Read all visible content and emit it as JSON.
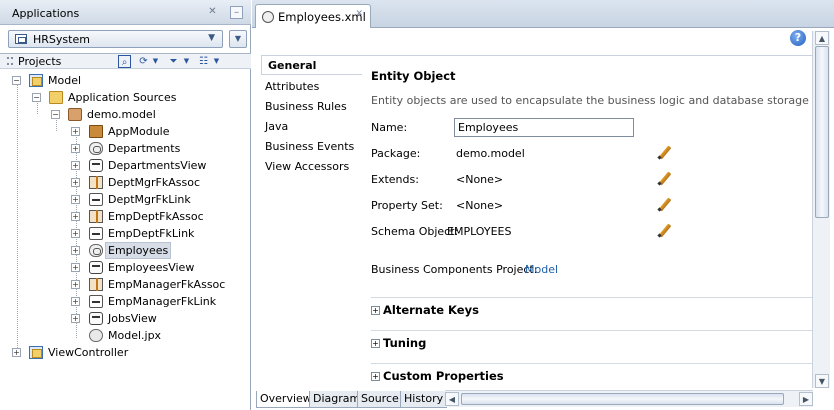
{
  "applications_panel": {
    "title": "Applications",
    "app_selected": "HRSystem",
    "projects_label": "Projects"
  },
  "tree": [
    {
      "label": "Model",
      "icon": "project-icon"
    },
    {
      "label": "Application Sources",
      "icon": "folder-icon"
    },
    {
      "label": "demo.model",
      "icon": "package-icon"
    },
    {
      "label": "AppModule",
      "icon": "app-module-icon"
    },
    {
      "label": "Departments",
      "icon": "entity-icon"
    },
    {
      "label": "DepartmentsView",
      "icon": "view-object-icon"
    },
    {
      "label": "DeptMgrFkAssoc",
      "icon": "association-icon"
    },
    {
      "label": "DeptMgrFkLink",
      "icon": "view-link-icon"
    },
    {
      "label": "EmpDeptFkAssoc",
      "icon": "association-icon"
    },
    {
      "label": "EmpDeptFkLink",
      "icon": "view-link-icon"
    },
    {
      "label": "Employees",
      "icon": "entity-icon"
    },
    {
      "label": "EmployeesView",
      "icon": "view-object-icon"
    },
    {
      "label": "EmpManagerFkAssoc",
      "icon": "association-icon"
    },
    {
      "label": "EmpManagerFkLink",
      "icon": "view-link-icon"
    },
    {
      "label": "JobsView",
      "icon": "view-object-icon"
    },
    {
      "label": "Model.jpx",
      "icon": "jpx-icon"
    },
    {
      "label": "ViewController",
      "icon": "project-icon"
    }
  ],
  "editor": {
    "tab_label": "Employees.xml",
    "nav": [
      "General",
      "Attributes",
      "Business Rules",
      "Java",
      "Business Events",
      "View Accessors"
    ],
    "title": "Entity Object",
    "description": "Entity objects are used to encapsulate the business logic and database storage details for yo",
    "fields": {
      "name_label": "Name:",
      "name_value": "Employees",
      "package_label": "Package:",
      "package_value": "demo.model",
      "extends_label": "Extends:",
      "extends_value": "<None>",
      "propset_label": "Property Set:",
      "propset_value": "<None>",
      "schema_label": "Schema Object:",
      "schema_value": "EMPLOYEES",
      "bcp_label": "Business Components Project:",
      "bcp_value": "Model"
    },
    "sections": [
      "Alternate Keys",
      "Tuning",
      "Custom Properties"
    ],
    "bottom_tabs": [
      "Overview",
      "Diagram",
      "Source",
      "History"
    ]
  }
}
